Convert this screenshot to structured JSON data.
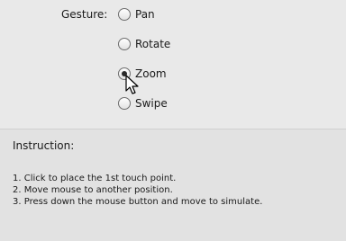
{
  "gesture": {
    "label": "Gesture:",
    "options": [
      {
        "label": "Pan",
        "selected": false
      },
      {
        "label": "Rotate",
        "selected": false
      },
      {
        "label": "Zoom",
        "selected": true
      },
      {
        "label": "Swipe",
        "selected": false
      }
    ]
  },
  "instruction": {
    "title": "Instruction:",
    "steps": [
      "1. Click to place the 1st touch point.",
      "2. Move mouse to another position.",
      "3. Press down the mouse button and move to simulate."
    ]
  }
}
